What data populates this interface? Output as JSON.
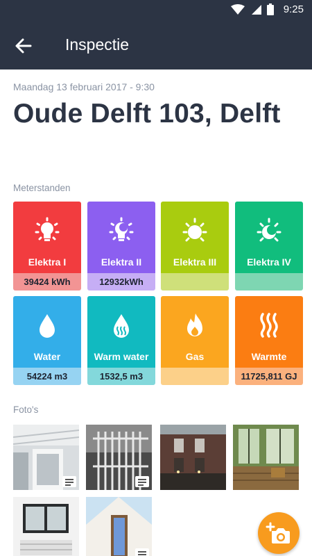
{
  "status_bar": {
    "time": "9:25"
  },
  "app_bar": {
    "title": "Inspectie"
  },
  "inspection": {
    "datetime": "Maandag 13 februari 2017 - 9:30",
    "address": "Oude Delft 103, Delft"
  },
  "meters": {
    "label": "Meterstanden",
    "items": [
      {
        "name": "Elektra I",
        "value": "39424 kWh",
        "icon": "bulb-icon",
        "color": "#f23c3f",
        "value_bg": "#f29494"
      },
      {
        "name": "Elektra II",
        "value": "12932kWh",
        "icon": "moon-bulb-icon",
        "color": "#8c5ff0",
        "value_bg": "#c6aef5"
      },
      {
        "name": "Elektra III",
        "value": "",
        "icon": "sun-icon",
        "color": "#a9cc0f",
        "value_bg": "#cfe07a"
      },
      {
        "name": "Elektra IV",
        "value": "",
        "icon": "sun-moon-icon",
        "color": "#11bd7d",
        "value_bg": "#7ed6b2"
      },
      {
        "name": "Water",
        "value": "54224 m3",
        "icon": "water-drop-icon",
        "color": "#33aee9",
        "value_bg": "#96d3f2"
      },
      {
        "name": "Warm water",
        "value": "1532,5 m3",
        "icon": "warm-water-drop-icon",
        "color": "#11bac0",
        "value_bg": "#83d8db"
      },
      {
        "name": "Gas",
        "value": "",
        "icon": "flame-icon",
        "color": "#fba61f",
        "value_bg": "#fcd089"
      },
      {
        "name": "Warmte",
        "value": "11725,811 GJ",
        "icon": "heat-waves-icon",
        "color": "#fb7d12",
        "value_bg": "#fbb17d"
      }
    ]
  },
  "photos": {
    "label": "Foto's",
    "items": [
      {
        "name": "photo-ceiling-window",
        "has_note": true
      },
      {
        "name": "photo-white-fence",
        "has_note": true
      },
      {
        "name": "photo-brick-houses",
        "has_note": false
      },
      {
        "name": "photo-greenhouse-door",
        "has_note": false
      },
      {
        "name": "photo-window-interior",
        "has_note": false
      },
      {
        "name": "photo-house-door",
        "has_note": true
      }
    ]
  },
  "fab": {
    "icon": "add-photo-icon"
  },
  "colors": {
    "app_bar": "#2c3444",
    "fab": "#f89b1e",
    "muted_text": "#8a93a3"
  }
}
